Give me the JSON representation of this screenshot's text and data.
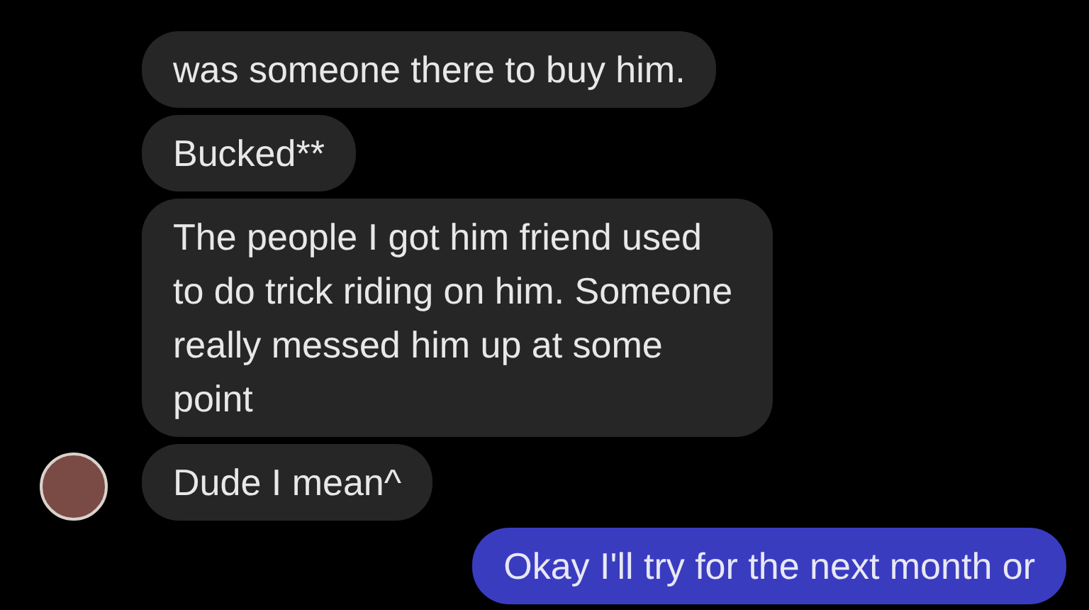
{
  "messages": [
    {
      "kind": "incoming",
      "text": "was someone there to buy him.",
      "avatar": false
    },
    {
      "kind": "incoming",
      "text": "Bucked**",
      "avatar": false
    },
    {
      "kind": "incoming",
      "text": "The people I got him friend used to do trick riding on him. Someone really messed him up at some point",
      "avatar": false
    },
    {
      "kind": "incoming",
      "text": "Dude I mean^",
      "avatar": true
    },
    {
      "kind": "outgoing",
      "text": "Okay I'll try for the next month or"
    }
  ]
}
